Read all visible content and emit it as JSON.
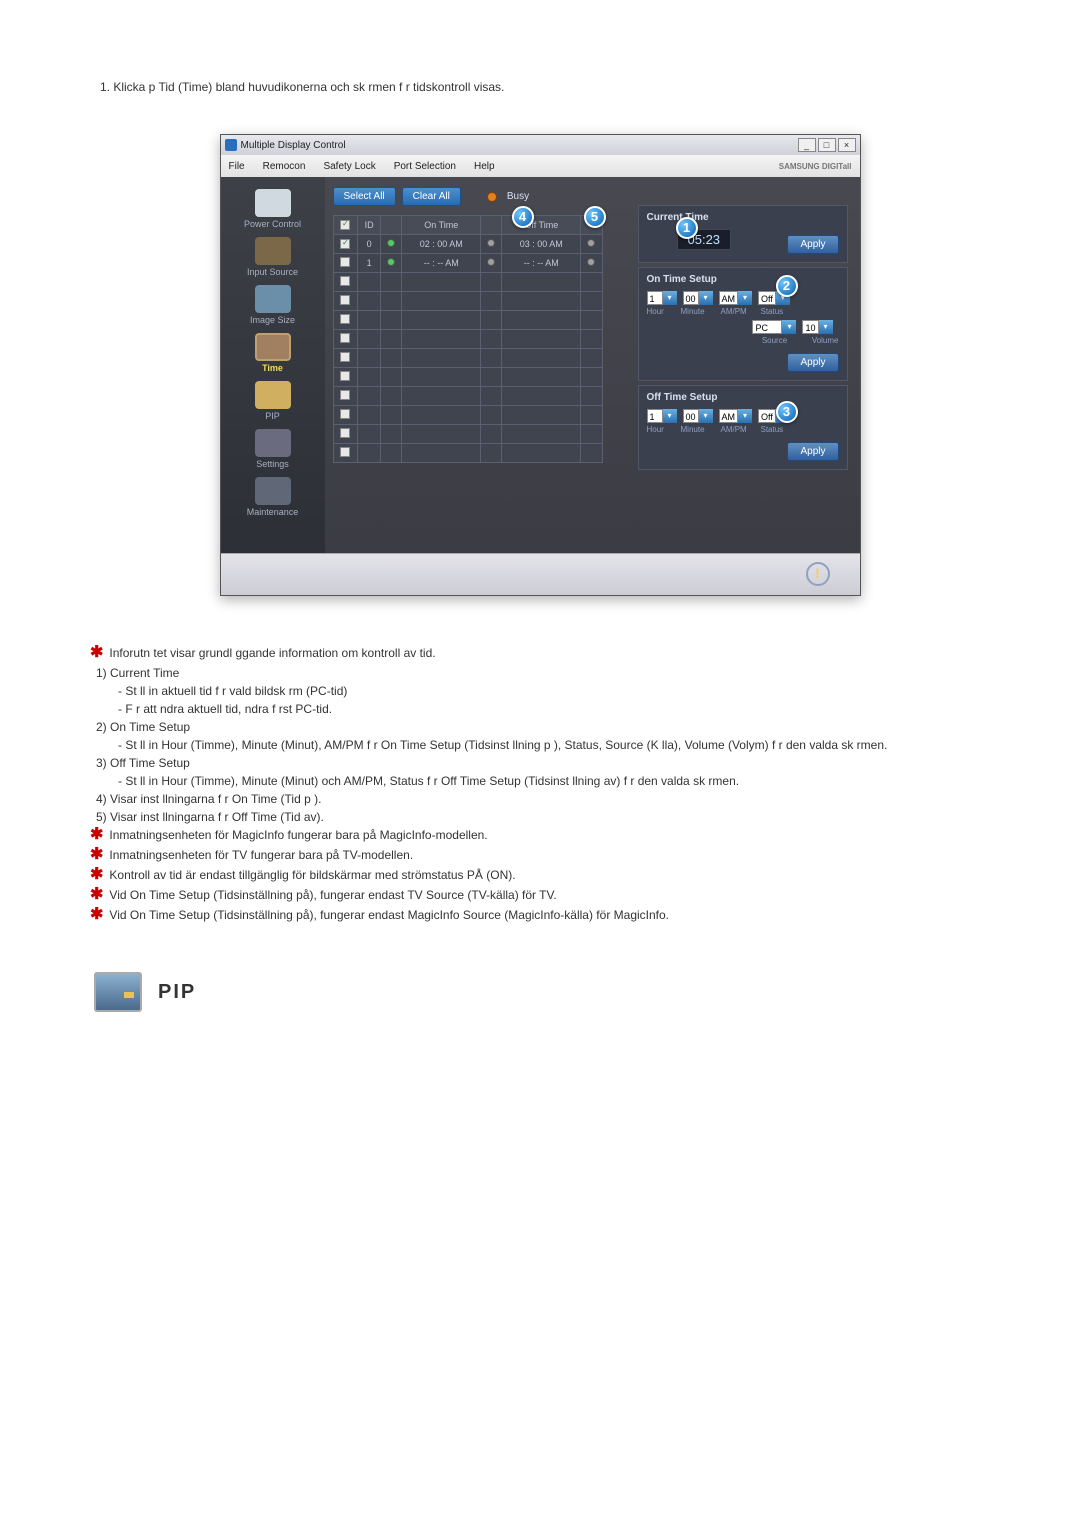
{
  "step1": "1. Klicka p Tid (Time) bland huvudikonerna och sk rmen f r tidskontroll visas.",
  "window": {
    "title": "Multiple Display Control",
    "menu": [
      "File",
      "Remocon",
      "Safety Lock",
      "Port Selection",
      "Help"
    ],
    "brand": "SAMSUNG DIGITall",
    "buttons": {
      "select_all": "Select All",
      "clear_all": "Clear All",
      "busy": "Busy"
    },
    "sidebar": [
      {
        "label": "Power Control",
        "icon": "power"
      },
      {
        "label": "Input Source",
        "icon": "input"
      },
      {
        "label": "Image Size",
        "icon": "image"
      },
      {
        "label": "Time",
        "icon": "time",
        "active": true
      },
      {
        "label": "PIP",
        "icon": "pip"
      },
      {
        "label": "Settings",
        "icon": "settings"
      },
      {
        "label": "Maintenance",
        "icon": "maint"
      }
    ],
    "grid": {
      "cols": [
        "",
        "ID",
        "",
        "On Time",
        "",
        "Off Time",
        ""
      ],
      "rows": [
        {
          "chk": true,
          "id": "0",
          "p": "g",
          "on": "02 : 00 AM",
          "onl": "o",
          "off": "03 : 00 AM",
          "offl": "o"
        },
        {
          "chk": false,
          "id": "1",
          "p": "g",
          "on": "-- : -- AM",
          "onl": "o",
          "off": "-- : -- AM",
          "offl": "o"
        }
      ]
    },
    "panel": {
      "current_time_label": "Current Time",
      "current_time": "05:23",
      "on_time_label": "On Time Setup",
      "off_time_label": "Off Time Setup",
      "hour": "1",
      "minute": "00",
      "ampm": "AM",
      "status": "Off",
      "source": "PC",
      "volume": "10",
      "labels": {
        "hour": "Hour",
        "minute": "Minute",
        "ampm": "AM/PM",
        "status": "Status",
        "source": "Source",
        "volume": "Volume"
      },
      "apply": "Apply"
    },
    "badges": {
      "b1": "1",
      "b2": "2",
      "b3": "3",
      "b4": "4",
      "b5": "5"
    }
  },
  "notes": {
    "n1": "Inforutn tet visar grundl ggande information om kontroll av tid.",
    "b1_title": "1) Current Time",
    "b1_d1": "- St ll in aktuell tid f r vald bildsk rm (PC-tid)",
    "b1_d2": "- F r att ndra aktuell tid, ndra f rst PC-tid.",
    "b2_title": "2) On Time Setup",
    "b2_d1": "- St ll in Hour (Timme), Minute (Minut), AM/PM f r On Time Setup (Tidsinst llning p ), Status, Source (K lla), Volume (Volym) f r den valda sk rmen.",
    "b3_title": "3) Off Time Setup",
    "b3_d1": "- St ll in Hour (Timme), Minute (Minut) och AM/PM, Status f r Off Time Setup (Tidsinst llning av) f r den valda sk rmen.",
    "b4_title": "4) Visar inst llningarna f r On Time (Tid p ).",
    "b5_title": "5) Visar inst llningarna f r Off Time (Tid av).",
    "s1": "Inmatningsenheten för MagicInfo fungerar bara på MagicInfo-modellen.",
    "s2": "Inmatningsenheten för TV fungerar bara på TV-modellen.",
    "s3": "Kontroll av tid är endast tillgänglig för bildskärmar med strömstatus PÅ (ON).",
    "s4": "Vid On Time Setup (Tidsinställning på), fungerar endast TV Source (TV-källa) för TV.",
    "s5": "Vid On Time Setup (Tidsinställning på), fungerar endast MagicInfo Source (MagicInfo-källa) för MagicInfo."
  },
  "pip_heading": "PIP"
}
